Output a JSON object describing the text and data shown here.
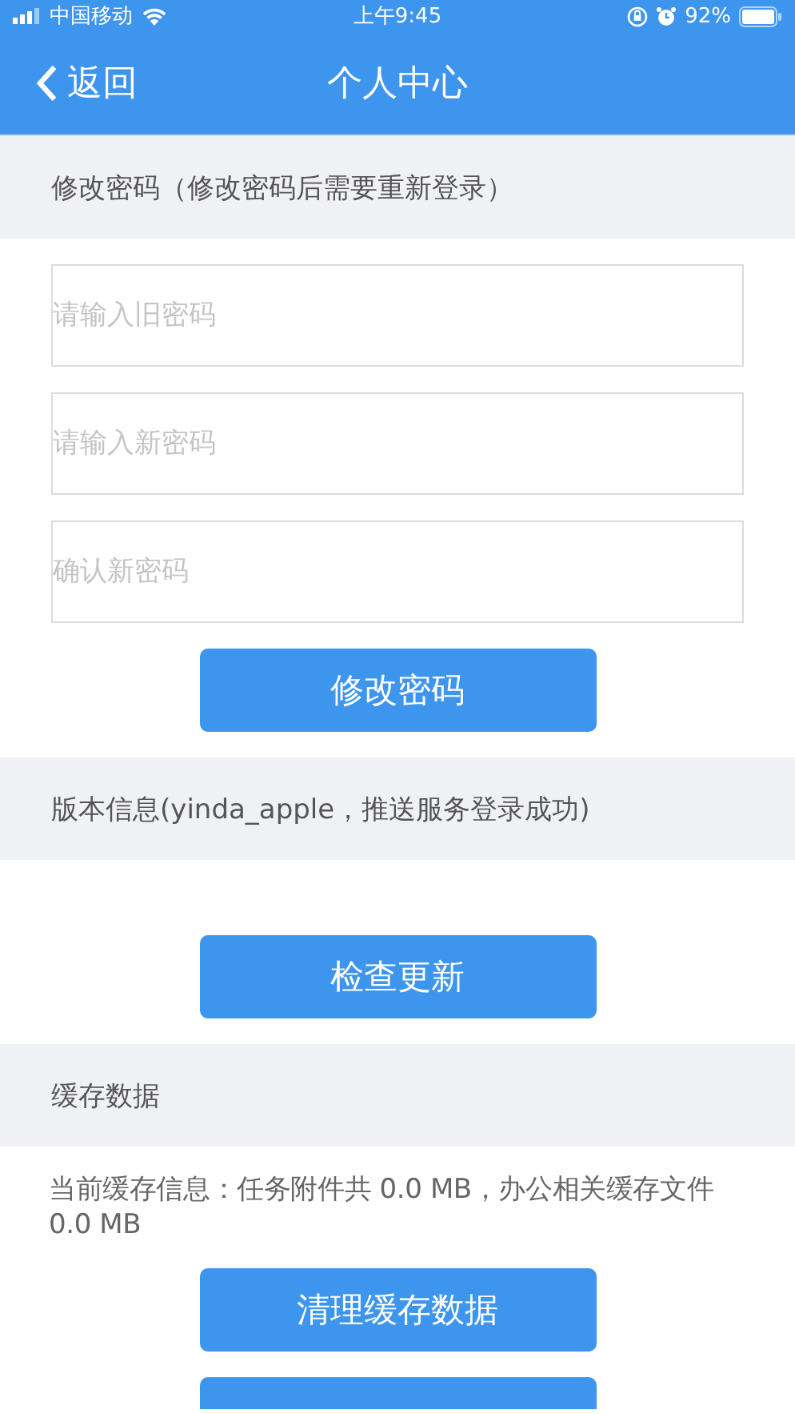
{
  "status_bar": {
    "carrier": "中国移动",
    "time": "上午9:45",
    "battery": "92%"
  },
  "nav": {
    "back": "返回",
    "title": "个人中心"
  },
  "sections": [
    {
      "header": "修改密码（修改密码后需要重新登录）",
      "fields": [
        {
          "placeholder": "请输入旧密码"
        },
        {
          "placeholder": "请输入新密码"
        },
        {
          "placeholder": "确认新密码"
        }
      ],
      "buttons": [
        {
          "kind": "full",
          "label": "修改密码"
        }
      ]
    },
    {
      "header": "版本信息(yinda_apple，推送服务登录成功)",
      "buttons": [
        {
          "kind": "full",
          "label": "检查更新"
        }
      ]
    },
    {
      "header": "缓存数据",
      "info": "当前缓存信息：任务附件共 0.0 MB，办公相关缓存文件 0.0 MB",
      "buttons": [
        {
          "kind": "full",
          "label": "清理缓存数据"
        },
        {
          "kind": "clipped"
        }
      ]
    }
  ]
}
